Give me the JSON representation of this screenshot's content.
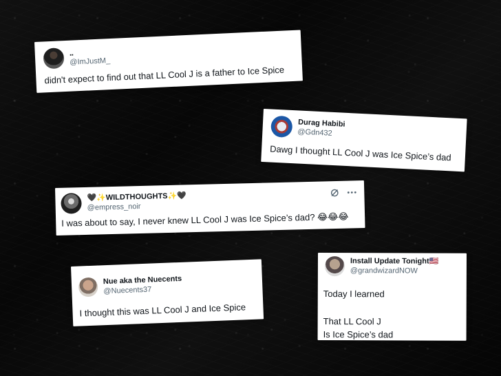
{
  "posts": [
    {
      "display_name": "..",
      "handle": "@ImJustM_",
      "text": "didn't expect to find out that LL Cool J is a father to Ice Spice",
      "avatar_icon": "user-avatar-icon"
    },
    {
      "display_name": "Durag Habibi",
      "handle": "@Gdn432",
      "text": "Dawg I thought LL Cool J was Ice Spice’s dad",
      "avatar_icon": "user-avatar-icon"
    },
    {
      "display_name": "🖤✨WILDTHOUGHTS✨🖤",
      "handle": "@empress_noir",
      "text": "I was about to say, I never knew LL Cool J was Ice Spice’s dad? 😂😂😂",
      "avatar_icon": "user-avatar-icon",
      "actions": [
        "grok-icon",
        "more-icon"
      ]
    },
    {
      "display_name": "Nue aka the Nuecents",
      "handle": "@Nuecents37",
      "text": "I thought this was LL Cool J and Ice Spice",
      "avatar_icon": "user-avatar-icon"
    },
    {
      "display_name": "Install Update Tonight🇺🇸",
      "handle": "@grandwizardNOW",
      "text": "Today I learned\n\nThat LL Cool J\nIs Ice Spice’s dad",
      "avatar_icon": "user-avatar-icon"
    }
  ],
  "colors": {
    "background": "#0b0b0b",
    "card": "#ffffff",
    "primary_text": "#0f1419",
    "secondary_text": "#536471"
  }
}
